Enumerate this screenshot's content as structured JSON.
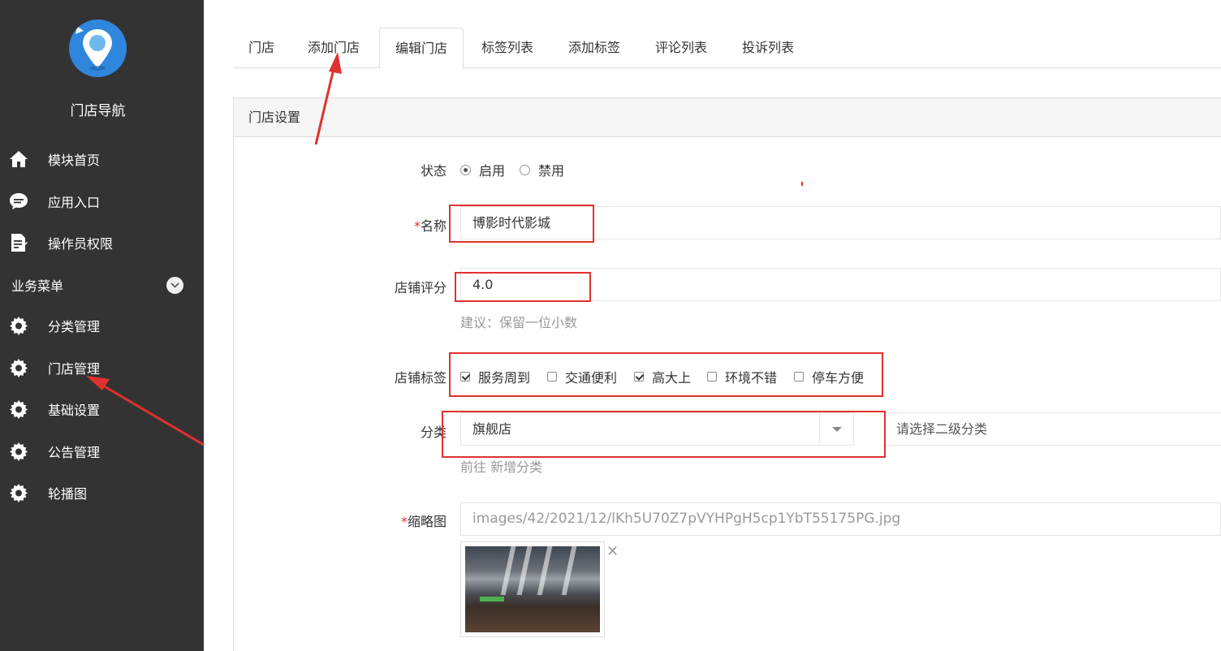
{
  "sidebar": {
    "brand": "门店导航",
    "items": [
      {
        "label": "模块首页",
        "icon": "home-icon"
      },
      {
        "label": "应用入口",
        "icon": "chat-icon"
      },
      {
        "label": "操作员权限",
        "icon": "document-icon"
      }
    ],
    "section_label": "业务菜单",
    "business_items": [
      {
        "label": "分类管理",
        "icon": "gear-icon"
      },
      {
        "label": "门店管理",
        "icon": "gear-icon"
      },
      {
        "label": "基础设置",
        "icon": "gear-icon"
      },
      {
        "label": "公告管理",
        "icon": "gear-icon"
      },
      {
        "label": "轮播图",
        "icon": "gear-icon"
      }
    ]
  },
  "tabs": [
    {
      "label": "门店"
    },
    {
      "label": "添加门店"
    },
    {
      "label": "编辑门店",
      "active": true
    },
    {
      "label": "标签列表"
    },
    {
      "label": "添加标签"
    },
    {
      "label": "评论列表"
    },
    {
      "label": "投诉列表"
    }
  ],
  "panel": {
    "title": "门店设置"
  },
  "form": {
    "status": {
      "label": "状态",
      "options": [
        "启用",
        "禁用"
      ],
      "selected": "启用"
    },
    "name": {
      "label": "名称",
      "required_mark": "*",
      "value": "博影时代影城"
    },
    "rating": {
      "label": "店铺评分",
      "value": "4.0",
      "hint": "建议：保留一位小数"
    },
    "tags": {
      "label": "店铺标签",
      "options": [
        {
          "label": "服务周到",
          "checked": true
        },
        {
          "label": "交通便利",
          "checked": false
        },
        {
          "label": "高大上",
          "checked": true
        },
        {
          "label": "环境不错",
          "checked": false
        },
        {
          "label": "停车方便",
          "checked": false
        }
      ]
    },
    "category": {
      "label": "分类",
      "value": "旗舰店",
      "secondary_hint": "请选择二级分类",
      "link_prefix": "前往",
      "link_text": "新增分类"
    },
    "thumbnail": {
      "label": "缩略图",
      "required_mark": "*",
      "path": "images/42/2021/12/lKh5U70Z7pVYHPgH5cp1YbT55175PG.jpg"
    }
  },
  "colors": {
    "sidebar_bg": "#333333",
    "annotation_red": "#e0312e",
    "logo_blue": "#2f86dd"
  }
}
